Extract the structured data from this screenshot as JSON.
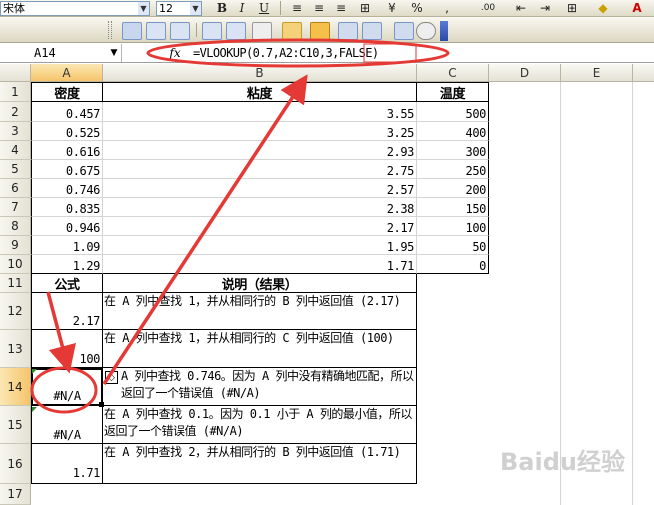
{
  "toolbar": {
    "font_name": "宋体",
    "font_size": "12",
    "bold_label": "B",
    "italic_label": "I",
    "underline_label": "U",
    "percent_label": "%",
    "comma_label": ",",
    "decimals_label": ".00",
    "font_color_label": "A"
  },
  "formula_bar": {
    "name_box": "A14",
    "fx_label": "fx",
    "formula": "=VLOOKUP(0.7,A2:C10,3,FALSE)"
  },
  "columns": [
    "A",
    "B",
    "C",
    "D",
    "E"
  ],
  "rows": [
    "1",
    "2",
    "3",
    "4",
    "5",
    "6",
    "7",
    "8",
    "9",
    "10",
    "11",
    "12",
    "13",
    "14",
    "15",
    "16",
    "17"
  ],
  "header": {
    "a": "密度",
    "b": "粘度",
    "c": "温度"
  },
  "data": [
    {
      "a": "0.457",
      "b": "3.55",
      "c": "500"
    },
    {
      "a": "0.525",
      "b": "3.25",
      "c": "400"
    },
    {
      "a": "0.616",
      "b": "2.93",
      "c": "300"
    },
    {
      "a": "0.675",
      "b": "2.75",
      "c": "250"
    },
    {
      "a": "0.746",
      "b": "2.57",
      "c": "200"
    },
    {
      "a": "0.835",
      "b": "2.38",
      "c": "150"
    },
    {
      "a": "0.946",
      "b": "2.17",
      "c": "100"
    },
    {
      "a": "1.09",
      "b": "1.95",
      "c": "50"
    },
    {
      "a": "1.29",
      "b": "1.71",
      "c": "0"
    }
  ],
  "lower_header": {
    "a": "公式",
    "b": "说明（结果）"
  },
  "results": [
    {
      "a": "2.17",
      "b": "在 A 列中查找 1，并从相同行的 B 列中返回值 (2.17)"
    },
    {
      "a": "100",
      "b": "在 A 列中查找 1，并从相同行的 C 列中返回值 (100)"
    },
    {
      "a": "#N/A",
      "b": "A 列中查找 0.746。因为 A 列中没有精确地匹配，所以返回了一个错误值 (#N/A)"
    },
    {
      "a": "#N/A",
      "b": "在 A 列中查找 0.1。因为 0.1 小于 A 列的最小值，所以返回了一个错误值 (#N/A)"
    },
    {
      "a": "1.71",
      "b": "在 A 列中查找 2，并从相同行的 B 列中返回值 (1.71)"
    }
  ],
  "watermark": "Baidu经验",
  "colors": {
    "annotation": "#e53935",
    "selected_header": "#f6c46b"
  }
}
